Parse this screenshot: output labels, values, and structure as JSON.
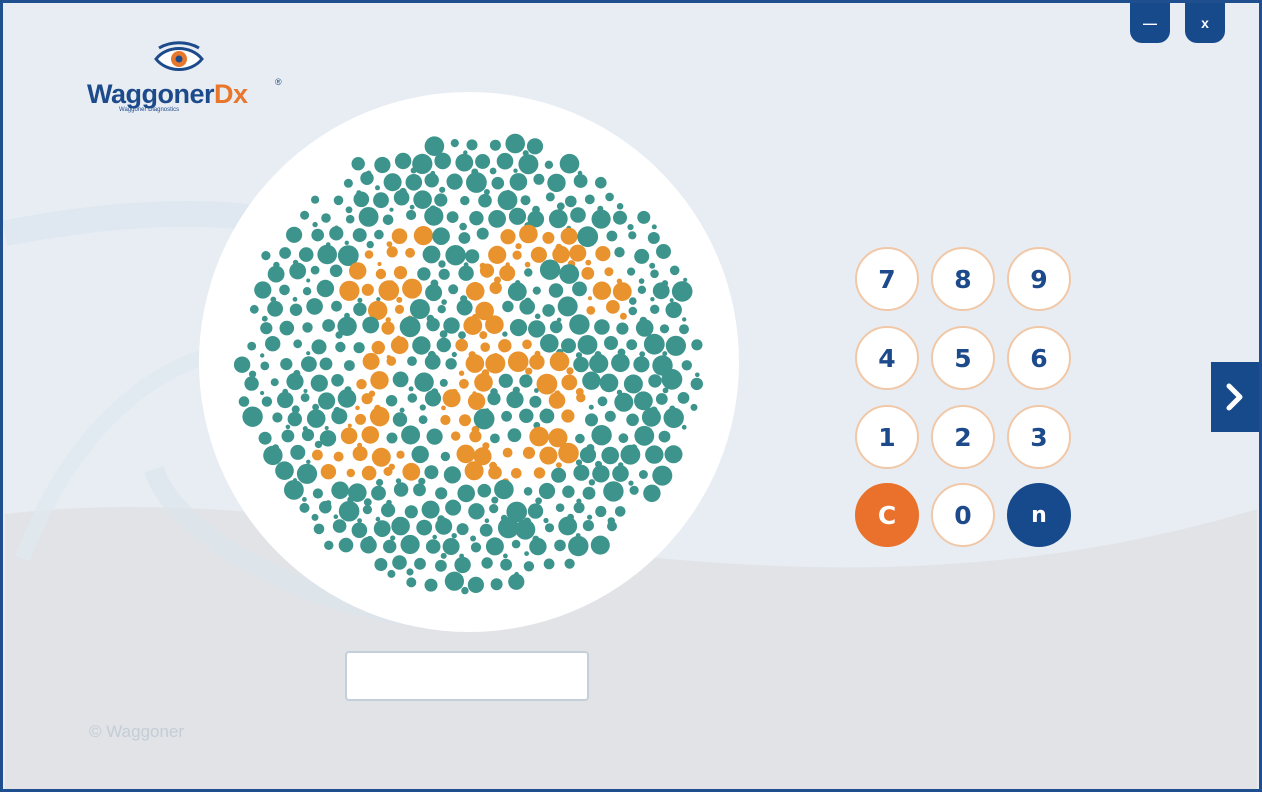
{
  "app": {
    "brand_name": "Waggoner",
    "brand_suffix": "Dx",
    "brand_mark": "®",
    "brand_tagline": "Waggoner Diagnostics"
  },
  "window_controls": {
    "minimize_label": "—",
    "close_label": "x"
  },
  "plate": {
    "hidden_number": "16",
    "background_dot_color": "#3d948c",
    "figure_dot_color": "#e8932d"
  },
  "answer_input": {
    "value": "",
    "placeholder": ""
  },
  "keypad": {
    "keys": [
      "7",
      "8",
      "9",
      "4",
      "5",
      "6",
      "1",
      "2",
      "3",
      "C",
      "0",
      "n"
    ]
  },
  "navigation": {
    "next_icon": "chevron-right-icon"
  },
  "footer": {
    "copyright": "© Waggoner"
  },
  "colors": {
    "primary": "#174a8b",
    "accent": "#e9712c",
    "background": "#e7edf3"
  }
}
